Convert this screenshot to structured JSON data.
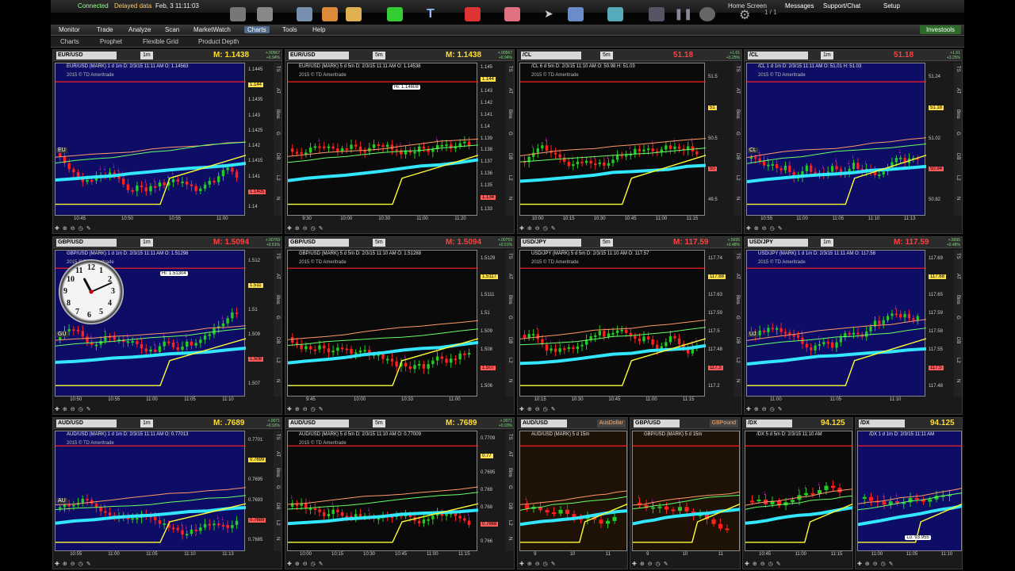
{
  "topbar": {
    "status": "Connected",
    "delay": "Delayed data",
    "datetime": "Feb, 3 11:11:03",
    "home_screen": "Home Screen",
    "messages": "Messages",
    "support": "Support/Chat",
    "setup": "Setup",
    "page_count": "1 / 1"
  },
  "menu": {
    "tabs": [
      "Monitor",
      "Trade",
      "Analyze",
      "Scan",
      "MarketWatch",
      "Charts",
      "Tools",
      "Help"
    ],
    "active": "Charts",
    "investools": "Investools"
  },
  "subnav": [
    "Charts",
    "Prophet",
    "Flexible Grid",
    "Product Depth"
  ],
  "colors": {
    "plot_blue": "#0d0d66",
    "plot_dark": "#0a0a0a",
    "plot_brown": "#1e1206",
    "ma_cyan": "#33e6ff",
    "yellow": "#ffff33",
    "red": "#ff2020",
    "green": "#22cc22",
    "magenta": "#ff33ff"
  },
  "charts": [
    {
      "symbol": "EUR/USD",
      "agg": "1m",
      "price": "M: 1.1438",
      "red": false,
      "chg1": "+.00567",
      "chg2": "+0.94%",
      "info": "EUR/USD (MARK) 1 d 1m   D: 2/3/15 11:11 AM   O: 1.14563",
      "copy": "2015 © TD Ameritrade",
      "yticks": [
        "1.1445",
        "1.144",
        "1.1435",
        "1.143",
        "1.1425",
        "1.142",
        "1.1415",
        "1.141",
        "1.1405",
        "1.14"
      ],
      "xticks": [
        "10:45",
        "10:50",
        "10:55",
        "11:00"
      ],
      "label": "EU",
      "bg": "blue"
    },
    {
      "symbol": "EUR/USD",
      "agg": "5m",
      "price": "M: 1.1438",
      "red": false,
      "chg1": "+.00567",
      "chg2": "+0.94%",
      "info": "EUR/USD (MARK) 5 d 5m   D: 2/3/15 11:11 AM   O: 1.14538",
      "copy": "2015 © TD Ameritrade",
      "yticks": [
        "1.145",
        "1.144",
        "1.143",
        "1.142",
        "1.141",
        "1.14",
        "1.139",
        "1.138",
        "1.137",
        "1.136",
        "1.135",
        "1.134",
        "1.133"
      ],
      "xticks": [
        "9:30",
        "10:00",
        "10:30",
        "11:00",
        "11:20"
      ],
      "hi": "Hi: 1.14608",
      "bg": "dark"
    },
    {
      "symbol": "/CL",
      "agg": "5m",
      "price": "51.18",
      "red": true,
      "chg1": "+1.61",
      "chg2": "+3.25%",
      "info": "/CL 6 d 5m   D: 2/3/15 11:10 AM   O: 50.98   H: 51.03",
      "copy": "2015 © TD Ameritrade",
      "yticks": [
        "51.5",
        "51",
        "50.5",
        "50",
        "49.5"
      ],
      "xticks": [
        "10:00",
        "10:15",
        "10:30",
        "10:45",
        "11:00",
        "11:15"
      ],
      "bg": "dark"
    },
    {
      "symbol": "/CL",
      "agg": "1m",
      "price": "51.18",
      "red": true,
      "chg1": "+1.61",
      "chg2": "+3.25%",
      "info": "/CL 1 d 1m   D: 2/3/15 11:11 AM   O: 51.01   H: 51.03",
      "copy": "2015 © TD Ameritrade",
      "yticks": [
        "51.24",
        "51.18",
        "51.02",
        "50.94",
        "50.82"
      ],
      "xticks": [
        "10:55",
        "11:00",
        "11:05",
        "11:10",
        "11:13"
      ],
      "label": "CL",
      "bg": "blue"
    },
    {
      "symbol": "GBP/USD",
      "agg": "1m",
      "price": "M: 1.5094",
      "red": true,
      "chg1": "+.00759",
      "chg2": "+0.51%",
      "info": "GBP/USD (MARK) 1 d 1m   D: 2/3/15 11:11 AM   O: 1.51298",
      "copy": "2015 © TD Ameritrade",
      "yticks": [
        "1.512",
        "1.511",
        "1.51",
        "1.509",
        "1.508",
        "1.507"
      ],
      "xticks": [
        "10:50",
        "10:55",
        "11:00",
        "11:05",
        "11:10"
      ],
      "hi": "Hi: 1.51304",
      "label": "GU",
      "bg": "blue"
    },
    {
      "symbol": "GBP/USD",
      "agg": "5m",
      "price": "M: 1.5094",
      "red": true,
      "chg1": "+.00759",
      "chg2": "+0.51%",
      "info": "GBP/USD (MARK) 5 d 5m   D: 2/3/15 11:10 AM   O: 1.51288",
      "copy": "2015 © TD Ameritrade",
      "yticks": [
        "1.5129",
        "1.5117",
        "1.5111",
        "1.51",
        "1.509",
        "1.508",
        "1.507",
        "1.506"
      ],
      "xticks": [
        "9:45",
        "10:00",
        "10:33",
        "11:00"
      ],
      "bg": "dark"
    },
    {
      "symbol": "USD/JPY",
      "agg": "5m",
      "price": "M: 117.59",
      "red": true,
      "chg1": "+.5695",
      "chg2": "+0.48%",
      "info": "USD/JPY (MARK) 5 d 5m   D: 2/3/15 11:10 AM   O: 117.57",
      "copy": "2015 © TD Ameritrade",
      "yticks": [
        "117.74",
        "117.68",
        "117.63",
        "117.59",
        "117.5",
        "117.48",
        "117.3",
        "117.2"
      ],
      "xticks": [
        "10:15",
        "10:30",
        "10:45",
        "11:00",
        "11:15"
      ],
      "bg": "dark"
    },
    {
      "symbol": "USD/JPY",
      "agg": "1m",
      "price": "M: 117.59",
      "red": true,
      "chg1": "+.5695",
      "chg2": "+0.48%",
      "info": "USD/JPY (MARK) 1 d 1m   D: 2/3/15 11:11 AM   O: 117.58",
      "copy": "2015 © TD Ameritrade",
      "yticks": [
        "117.69",
        "117.68",
        "117.65",
        "117.59",
        "117.58",
        "117.55",
        "117.5",
        "117.48"
      ],
      "xticks": [
        "11:00",
        "11:05",
        "11:10"
      ],
      "label": "UJ",
      "bg": "blue"
    },
    {
      "symbol": "AUD/USD",
      "agg": "1m",
      "price": "M: .7689",
      "red": false,
      "chg1": "+.0071",
      "chg2": "+0.93%",
      "info": "AUD/USD (MARK) 1 d 1m   D: 2/3/15 11:11 AM   O: 0.77013",
      "copy": "2015 © TD Ameritrade",
      "yticks": [
        "0.7701",
        "0.7699",
        "0.7695",
        "0.7693",
        "0.7689",
        "0.7685"
      ],
      "xticks": [
        "10:55",
        "11:00",
        "11:05",
        "11:10",
        "11:13"
      ],
      "label": "AU",
      "bg": "blue"
    },
    {
      "symbol": "AUD/USD",
      "agg": "5m",
      "price": "M: .7689",
      "red": false,
      "chg1": "+.0071",
      "chg2": "+0.93%",
      "info": "AUD/USD (MARK) 5 d 5m   D: 2/3/15 11:10 AM   O: 0.77009",
      "copy": "2015 © TD Ameritrade",
      "yticks": [
        "0.7709",
        "0.77",
        "0.7695",
        "0.769",
        "0.768",
        "0.7668",
        "0.766"
      ],
      "xticks": [
        "10:00",
        "10:15",
        "10:30",
        "10:45",
        "11:00",
        "11:15"
      ],
      "bg": "dark"
    },
    {
      "symbol": "AUD/USD",
      "agg": "",
      "price": "",
      "red": false,
      "chg1": "",
      "chg2": "",
      "info": "AUD/USD (MARK) 5 d 15m",
      "copy": "",
      "yticks": [],
      "xticks": [
        "9",
        "10",
        "11"
      ],
      "bg": "brown",
      "extra": "AusDollar"
    },
    {
      "symbol": "GBP/USD",
      "agg": "",
      "price": "",
      "red": false,
      "chg1": "",
      "chg2": "",
      "info": "GBP/USD (MARK) 5 d 15m",
      "copy": "",
      "yticks": [],
      "xticks": [
        "9",
        "10",
        "11"
      ],
      "bg": "brown",
      "extra": "GBPound"
    },
    {
      "symbol": "/DX",
      "agg": "",
      "price": "94.125",
      "red": false,
      "chg1": "",
      "chg2": "",
      "info": "/DX 5 d 5m   D: 2/3/15 11:10 AM",
      "copy": "",
      "yticks": [],
      "xticks": [
        "10:45",
        "11:00",
        "11:15"
      ],
      "bg": "dark"
    },
    {
      "symbol": "/DX",
      "agg": "",
      "price": "94.125",
      "red": false,
      "chg1": "",
      "chg2": "",
      "info": "/DX 1 d 1m   D: 2/3/15 11:11 AM",
      "copy": "",
      "yticks": [],
      "xticks": [
        "11:00",
        "11:05",
        "11:10"
      ],
      "bg": "blue",
      "lo": "Lo: 93.955"
    }
  ],
  "clock": {
    "numbers": [
      "12",
      "1",
      "2",
      "3",
      "4",
      "5",
      "6",
      "7",
      "8",
      "9",
      "10",
      "11"
    ],
    "hour_angle": 332,
    "minute_angle": 66
  },
  "side_tabs": [
    "TS",
    "AT",
    "Bins",
    "G",
    "DB",
    "L2",
    "N"
  ]
}
